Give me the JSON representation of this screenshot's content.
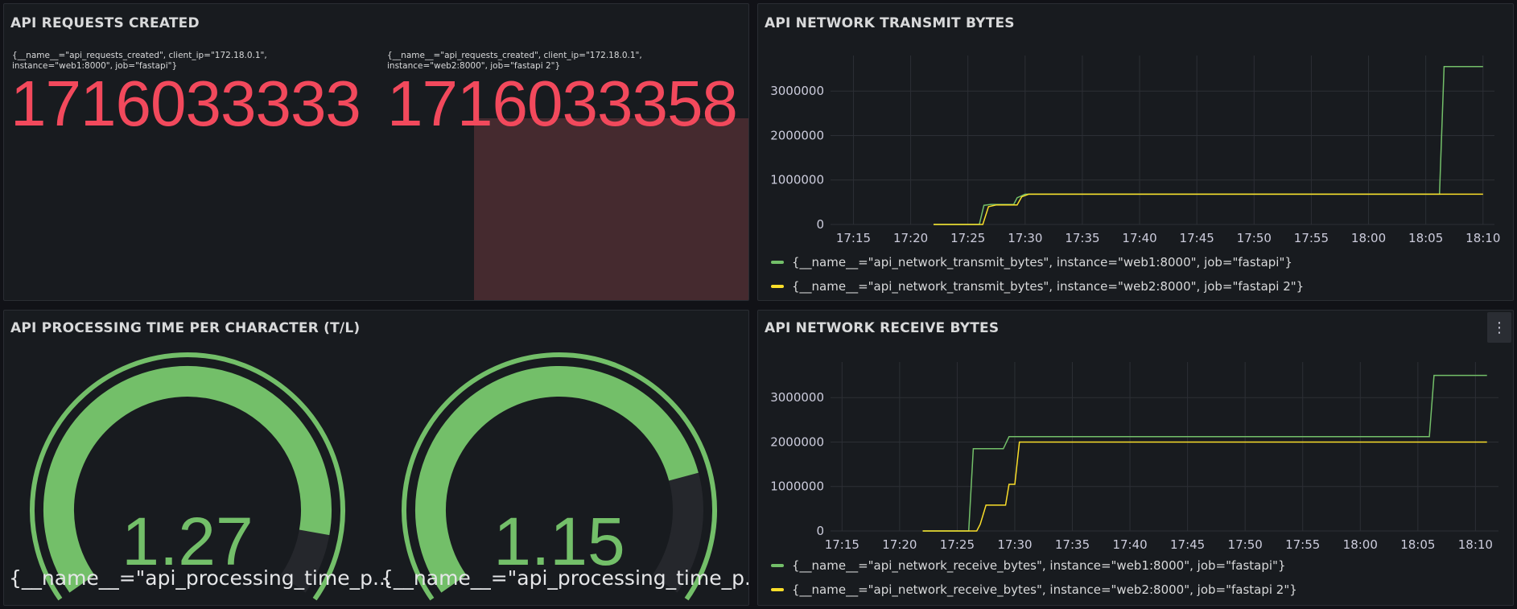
{
  "panels": {
    "requests": {
      "title": "API REQUESTS CREATED",
      "stats": [
        {
          "label": "{__name__=\"api_requests_created\", client_ip=\"172.18.0.1\", instance=\"web1:8000\", job=\"fastapi\"}",
          "value": "1716033333"
        },
        {
          "label": "{__name__=\"api_requests_created\", client_ip=\"172.18.0.1\", instance=\"web2:8000\", job=\"fastapi 2\"}",
          "value": "1716033358"
        }
      ]
    },
    "transmit": {
      "title": "API NETWORK TRANSMIT BYTES",
      "legend": [
        {
          "label": "{__name__=\"api_network_transmit_bytes\", instance=\"web1:8000\", job=\"fastapi\"}",
          "color": "#73bf69"
        },
        {
          "label": "{__name__=\"api_network_transmit_bytes\", instance=\"web2:8000\", job=\"fastapi 2\"}",
          "color": "#fade2a"
        }
      ]
    },
    "processing": {
      "title": "API PROCESSING TIME PER CHARACTER (T/L)",
      "gauges": [
        {
          "value": "1.27",
          "label": "{__name__=\"api_processing_time_p..."
        },
        {
          "value": "1.15",
          "label": "{__name__=\"api_processing_time_p..."
        }
      ]
    },
    "receive": {
      "title": "API NETWORK RECEIVE BYTES",
      "menu_icon": "kebab-menu-icon",
      "legend": [
        {
          "label": "{__name__=\"api_network_receive_bytes\", instance=\"web1:8000\", job=\"fastapi\"}",
          "color": "#73bf69"
        },
        {
          "label": "{__name__=\"api_network_receive_bytes\", instance=\"web2:8000\", job=\"fastapi 2\"}",
          "color": "#fade2a"
        }
      ]
    }
  },
  "chart_data": [
    {
      "type": "line",
      "title": "API NETWORK TRANSMIT BYTES",
      "x_ticks": [
        "17:15",
        "17:20",
        "17:25",
        "17:30",
        "17:35",
        "17:40",
        "17:45",
        "17:50",
        "17:55",
        "18:00",
        "18:05",
        "18:10"
      ],
      "y_ticks": [
        "0",
        "1000000",
        "2000000",
        "3000000"
      ],
      "ylim": [
        0,
        3800000
      ],
      "x_range_min": [
        -2,
        56
      ],
      "grid": true,
      "series": [
        {
          "name": "{__name__=\"api_network_transmit_bytes\", instance=\"web1:8000\", job=\"fastapi\"}",
          "color": "#73bf69",
          "points": [
            [
              7,
              0
            ],
            [
              11,
              0
            ],
            [
              11.4,
              430000
            ],
            [
              12,
              450000
            ],
            [
              14,
              450000
            ],
            [
              14.3,
              600000
            ],
            [
              15,
              680000
            ],
            [
              51.2,
              680000
            ],
            [
              51.6,
              3550000
            ],
            [
              55,
              3550000
            ]
          ]
        },
        {
          "name": "{__name__=\"api_network_transmit_bytes\", instance=\"web2:8000\", job=\"fastapi 2\"}",
          "color": "#fade2a",
          "points": [
            [
              7,
              0
            ],
            [
              11.3,
              0
            ],
            [
              11.8,
              400000
            ],
            [
              12.5,
              440000
            ],
            [
              14.3,
              440000
            ],
            [
              14.7,
              620000
            ],
            [
              15.3,
              680000
            ],
            [
              55,
              680000
            ]
          ]
        }
      ]
    },
    {
      "type": "line",
      "title": "API NETWORK RECEIVE BYTES",
      "x_ticks": [
        "17:15",
        "17:20",
        "17:25",
        "17:30",
        "17:35",
        "17:40",
        "17:45",
        "17:50",
        "17:55",
        "18:00",
        "18:05",
        "18:10"
      ],
      "y_ticks": [
        "0",
        "1000000",
        "2000000",
        "3000000"
      ],
      "ylim": [
        0,
        3800000
      ],
      "x_range_min": [
        -1,
        57
      ],
      "grid": true,
      "series": [
        {
          "name": "{__name__=\"api_network_receive_bytes\", instance=\"web1:8000\", job=\"fastapi\"}",
          "color": "#73bf69",
          "points": [
            [
              7,
              0
            ],
            [
              11,
              0
            ],
            [
              11.4,
              1850000
            ],
            [
              14,
              1850000
            ],
            [
              14.5,
              2120000
            ],
            [
              51,
              2120000
            ],
            [
              51.4,
              3500000
            ],
            [
              56,
              3500000
            ]
          ]
        },
        {
          "name": "{__name__=\"api_network_receive_bytes\", instance=\"web2:8000\", job=\"fastapi 2\"}",
          "color": "#fade2a",
          "points": [
            [
              7,
              0
            ],
            [
              11.7,
              0
            ],
            [
              12,
              150000
            ],
            [
              12.5,
              580000
            ],
            [
              14.2,
              580000
            ],
            [
              14.5,
              1050000
            ],
            [
              15,
              1050000
            ],
            [
              15.4,
              2000000
            ],
            [
              56,
              2000000
            ]
          ]
        }
      ]
    },
    {
      "type": "gauge",
      "title": "API PROCESSING TIME PER CHARACTER (T/L)",
      "values": [
        1.27,
        1.15
      ],
      "fill_fraction": [
        0.9,
        0.8
      ],
      "color": "#73bf69"
    }
  ]
}
